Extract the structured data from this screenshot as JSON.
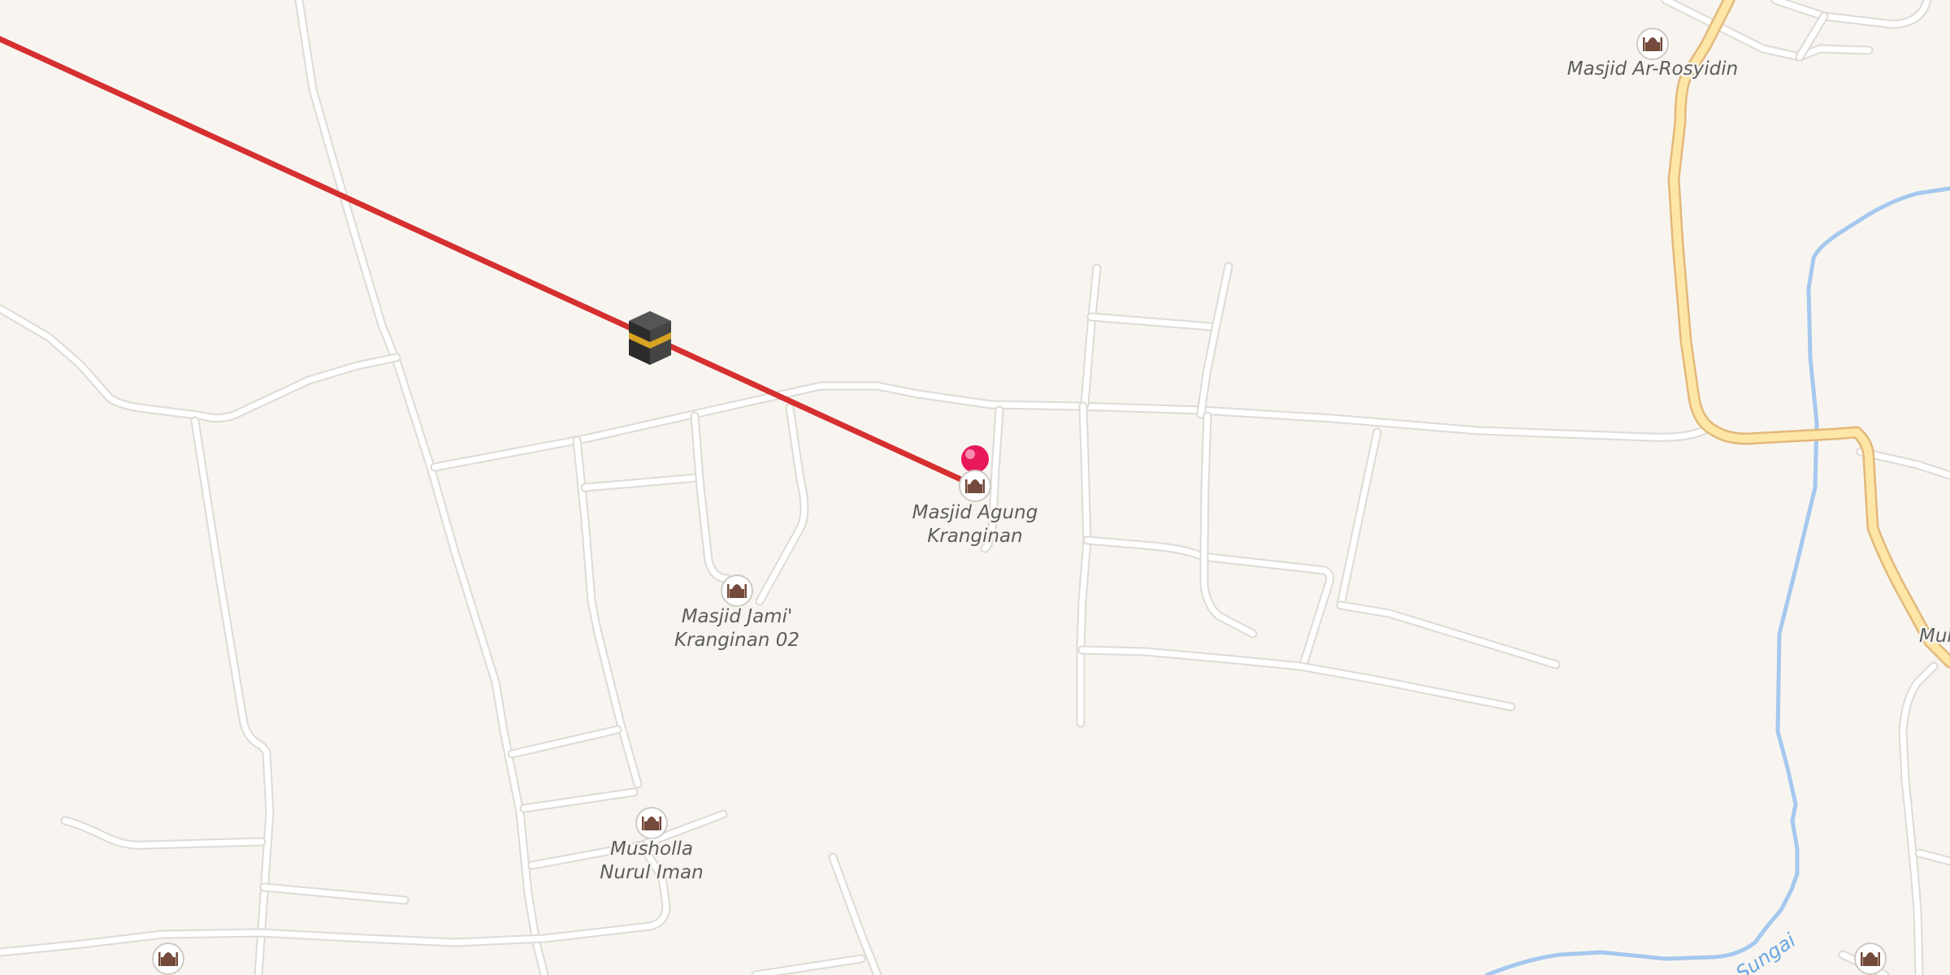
{
  "map": {
    "pois": [
      {
        "id": "masjid-ar-rosyidin",
        "label": "Masjid Ar-Rosyidin",
        "icon": "mosque-icon"
      },
      {
        "id": "masjid-agung-kranginan",
        "line1": "Masjid Agung",
        "line2": "Kranginan",
        "icon": "mosque-icon"
      },
      {
        "id": "masjid-jami-kranginan-02",
        "line1": "Masjid Jami'",
        "line2": "Kranginan 02",
        "icon": "mosque-icon"
      },
      {
        "id": "musholla-nurul-iman",
        "line1": "Musholla",
        "line2": "Nurul Iman",
        "icon": "mosque-icon"
      },
      {
        "id": "muh-partial",
        "label": "Muh",
        "icon": "mosque-icon"
      }
    ],
    "river_label": "Sungai",
    "qibla_marker_icon": "kaaba-icon",
    "location_pin_icon": "map-pin-icon",
    "colors": {
      "background": "#f8f5f1",
      "road": "#ffffff",
      "primary_road": "#fde6a6",
      "river": "#a5c8ee",
      "qibla_line": "#d62f2f",
      "pin": "#e8195a"
    }
  }
}
